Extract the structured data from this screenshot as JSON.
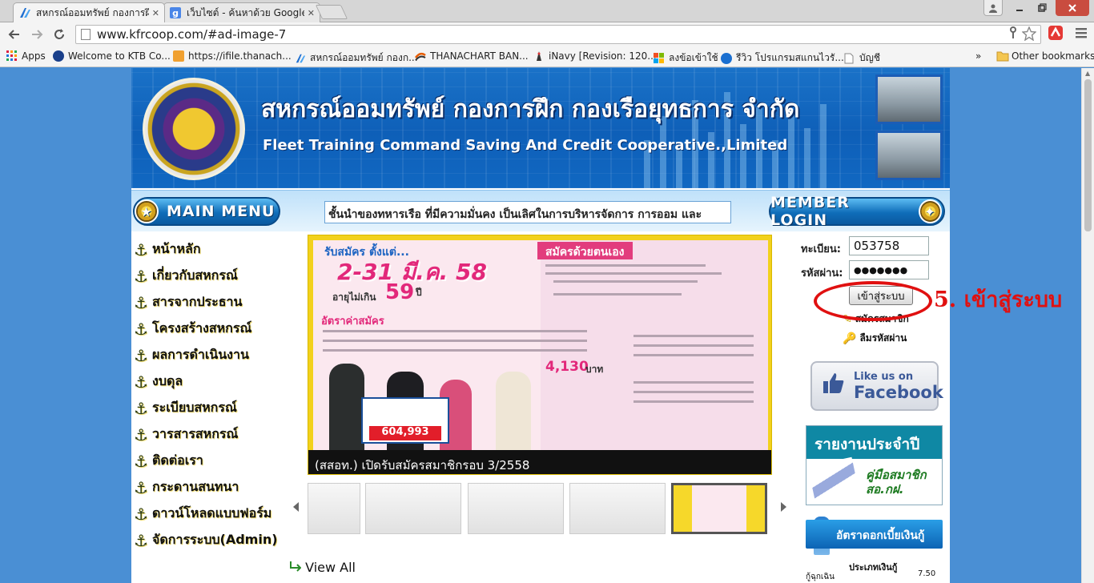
{
  "browser": {
    "tabs": [
      {
        "title": "สหกรณ์ออมทรัพย์ กองการฝึก",
        "close": "✕"
      },
      {
        "title": "เว็บไซต์ - ค้นหาด้วย Google",
        "close": "✕"
      }
    ],
    "url": "www.kfrcoop.com/#ad-image-7",
    "bookmarks": [
      "Apps",
      "Welcome to KTB Co...",
      "https://ifile.thanach...",
      "สหกรณ์ออมทรัพย์ กองก...",
      "THANACHART BAN...",
      "iNavy [Revision: 120...",
      "ลงข้อเข้าใช้",
      "รีวิว โปรแกรมสแกนไวรั...",
      "บัญชี"
    ],
    "bookmarks_more": "»",
    "other_bookmarks": "Other bookmarks"
  },
  "site": {
    "title_th": "สหกรณ์ออมทรัพย์ กองการฝึก กองเรือยุทธการ จำกัด",
    "title_en": "Fleet Training Command Saving And Credit Cooperative.,Limited",
    "main_menu": "MAIN MENU",
    "member_login": "MEMBER LOGIN",
    "marquee": "ชั้นนำของทหารเรือ  ที่มีความมั่นคง  เป็นเลิศในการบริหารจัดการ  การออม  และ"
  },
  "menu": [
    "หน้าหลัก",
    "เกี่ยวกับสหกรณ์",
    "สารจากประธาน",
    "โครงสร้างสหกรณ์",
    "ผลการดำเนินงาน",
    "งบดุล",
    "ระเบียบสหกรณ์",
    "วารสารสหกรณ์",
    "ติดต่อเรา",
    "กระดานสนทนา",
    "ดาวน์โหลดแบบฟอร์ม",
    "จัดการระบบ(Admin)"
  ],
  "slide": {
    "headline_small": "รับสมัคร ตั้งแต่...",
    "headline_date": "2-31 มี.ค. 58",
    "age_text": "อายุไม่เกิน",
    "age_num": "59",
    "age_unit": "ปี",
    "right_head": "สมัครด้วยตนเอง",
    "fee_head": "อัตราค่าสมัคร",
    "amount": "4,130",
    "amount_unit": "บาท",
    "prize": "604,993",
    "caption": "(สสอท.) เปิดรับสมัครสมาชิกรอบ 3/2558"
  },
  "view_all": "View All",
  "login": {
    "username_label": "ทะเบียน:",
    "username_value": "053758",
    "password_label": "รหัสผ่าน:",
    "password_value": "●●●●●●●",
    "button": "เข้าสู่ระบบ",
    "register": "สมัครสมาชิก",
    "forgot": "ลืมรหัสผ่าน"
  },
  "facebook": {
    "line1": "Like us on",
    "line2": "Facebook"
  },
  "annual_report": {
    "title": "รายงานประจำปี",
    "subtitle": "คู่มือสมาชิก สอ.กฝ."
  },
  "interest": {
    "title": "อัตราดอกเบี้ยเงินกู้",
    "header": "ประเภทเงินกู้",
    "row_label": "กู้ฉุกเฉิน",
    "row_value": "7.50"
  },
  "annotation": "5. เข้าสู่ระบบ",
  "colors": {
    "annotation": "#e01010",
    "banner": "#0e5fb8",
    "slide_frame": "#f2d11c"
  }
}
